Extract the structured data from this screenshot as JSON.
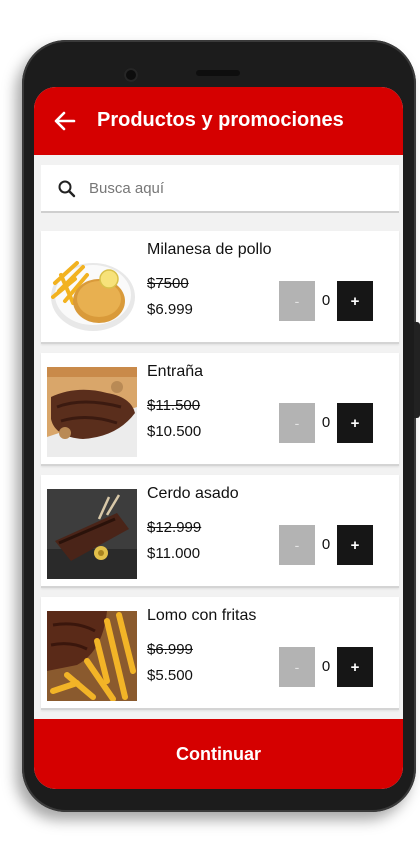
{
  "header": {
    "title": "Productos y promociones",
    "back_icon": "arrow-left-icon"
  },
  "search": {
    "placeholder": "Busca aquí",
    "icon": "search-icon"
  },
  "products": [
    {
      "name": "Milanesa de pollo",
      "old_price": "$7500",
      "new_price": "$6.999",
      "minus_label": "-",
      "quantity": "0",
      "plus_label": "+"
    },
    {
      "name": "Entraña",
      "old_price": "$11.500",
      "new_price": "$10.500",
      "minus_label": "-",
      "quantity": "0",
      "plus_label": "+"
    },
    {
      "name": "Cerdo asado",
      "old_price": "$12.999",
      "new_price": "$11.000",
      "minus_label": "-",
      "quantity": "0",
      "plus_label": "+"
    },
    {
      "name": "Lomo con fritas",
      "old_price": "$6.999",
      "new_price": "$5.500",
      "minus_label": "-",
      "quantity": "0",
      "plus_label": "+"
    }
  ],
  "footer": {
    "continue_label": "Continuar"
  },
  "colors": {
    "brand_red": "#d50000",
    "plus_button": "#161616",
    "minus_button": "#b3b3b3"
  }
}
